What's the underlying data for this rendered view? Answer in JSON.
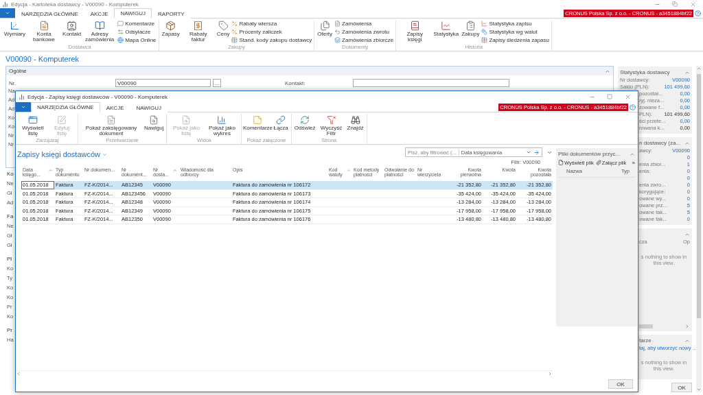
{
  "window": {
    "title": "Edycja - Kartoteka dostawcy - V00090 - Komputerek",
    "company": "CRONUS Polska Sp. z o.o. - CRONUS - a3451884bf22"
  },
  "tabs": [
    {
      "label": "NARZĘDZIA GŁÓWNE",
      "selected": false
    },
    {
      "label": "AKCJE",
      "selected": false
    },
    {
      "label": "NAWIGUJ",
      "selected": true
    },
    {
      "label": "RAPORTY",
      "selected": false
    }
  ],
  "ribbon": [
    {
      "label": "Dostawca",
      "items": [
        {
          "kind": "large",
          "label": "Wymiary"
        },
        {
          "kind": "large",
          "label": "Konta bankowe"
        },
        {
          "kind": "large",
          "label": "Kontakt"
        },
        {
          "kind": "large",
          "label": "Adresy zamówienia"
        },
        {
          "kind": "small",
          "label": "Komentarze"
        },
        {
          "kind": "small",
          "label": "Odsyłacze"
        },
        {
          "kind": "small",
          "label": "Mapa Online"
        }
      ]
    },
    {
      "label": "Zakupy",
      "items": [
        {
          "kind": "large",
          "label": "Zapasy"
        },
        {
          "kind": "large",
          "label": "Rabaty faktur"
        },
        {
          "kind": "large",
          "label": "Ceny"
        },
        {
          "kind": "small",
          "label": "Rabaty wiersza"
        },
        {
          "kind": "small",
          "label": "Procenty zaliczek"
        },
        {
          "kind": "small",
          "label": "Stand. kody zakupu dostawcy"
        }
      ]
    },
    {
      "label": "Dokumenty",
      "items": [
        {
          "kind": "large",
          "label": "Oferty"
        },
        {
          "kind": "small",
          "label": "Zamówienia"
        },
        {
          "kind": "small",
          "label": "Zamówienia zwrotu"
        },
        {
          "kind": "small",
          "label": "Zamówienia zbiorcze"
        }
      ]
    },
    {
      "label": "Historia",
      "items": [
        {
          "kind": "large",
          "label": "Zapisy księgi"
        },
        {
          "kind": "large",
          "label": "Statystyka"
        },
        {
          "kind": "large",
          "label": "Zakupy"
        },
        {
          "kind": "small",
          "label": "Statystyka zapisu"
        },
        {
          "kind": "small",
          "label": "Statystyka wg walut"
        },
        {
          "kind": "small",
          "label": "Zapisy śledzenia zapasu"
        }
      ]
    }
  ],
  "page_title": "V00090 - Komputerek",
  "general": {
    "title": "Ogólne",
    "nr_label": "Nr.",
    "nr_value": "V00090",
    "lookup": "...",
    "contact_label": "Kontakt:",
    "covered_labels": [
      "Na",
      "Ad",
      "Ad",
      "Ko",
      "Ko",
      "Nr",
      "Nr"
    ]
  },
  "sections_below": [
    {
      "header": "Ko",
      "labels": [
        "Ne",
        "Gł",
        "Ad"
      ]
    },
    {
      "header": "Fa",
      "labels": [
        "Ne",
        "Gł",
        "Gł"
      ]
    },
    {
      "header": "Pł",
      "labels": [
        "Ko",
        "Ty",
        "Ko",
        "Ko",
        "Pr",
        "Ko"
      ]
    },
    {
      "header": "Pr",
      "labels": [
        "Ha"
      ]
    }
  ],
  "factboxes": [
    {
      "kind": "stats",
      "title": "Statystyka dostawcy",
      "rows": [
        {
          "label": "Nr dostawcy:",
          "value": "V00090",
          "link": true
        },
        {
          "label": "Saldo (PLN):",
          "value": "101 499,60",
          "link": true
        },
        {
          "label": "pozostał...",
          "value": "0,00",
          "link": true
        },
        {
          "label": "ryj. nieza...",
          "value": "0,00",
          "link": true
        },
        {
          "label": "zowane f...",
          "value": "0,00",
          "link": true
        },
        {
          "label": "PLN):",
          "value": "101 499,60",
          "link": false
        },
        {
          "label": "ści przete...",
          "value": "0,00",
          "link": true
        },
        {
          "label": "rowana k...",
          "value": "0,00",
          "link": false
        }
      ]
    },
    {
      "kind": "stats",
      "title": "n dostawcy (za...",
      "rows": [
        {
          "label": "awcy:",
          "value": "V00090",
          "link": true
        },
        {
          "value": "0",
          "link": true
        },
        {
          "label": "enia zbior...",
          "value": "1",
          "link": true
        },
        {
          "label": "enia:",
          "value": "0",
          "link": true
        },
        {
          "value": "0",
          "link": true
        },
        {
          "label": "enia zwro...",
          "value": "0",
          "link": true
        },
        {
          "label": "korygujące:",
          "value": "0",
          "link": true
        },
        {
          "label": "owane wy...",
          "value": "0",
          "link": true
        },
        {
          "label": "owane prz...",
          "value": "5",
          "link": true
        },
        {
          "label": "owane fak...",
          "value": "5",
          "link": true
        },
        {
          "label": "owane fak...",
          "value": "0",
          "link": true
        }
      ]
    },
    {
      "kind": "list",
      "columns": [
        "cza",
        "Op"
      ],
      "empty": "s nothing to show in this view."
    },
    {
      "kind": "notes",
      "title": "tarze",
      "link": "taj, aby utworzyć nowy ...",
      "empty": "s nothing to show in this view."
    }
  ],
  "ok": "OK",
  "dialog": {
    "title": "Edycja - Zapisy księgi dostawców - V00090 - Komputerek",
    "company": "CRONUS Polska Sp. z o.o. - CRONUS - a3451884bf22",
    "tabs": [
      {
        "label": "NARZĘDZIA GŁÓWNE",
        "selected": true
      },
      {
        "label": "AKCJE",
        "selected": false
      },
      {
        "label": "NAWIGUJ",
        "selected": false
      }
    ],
    "ribbon": [
      {
        "label": "Zarządzaj",
        "items": [
          {
            "label": "Wyświetl listę",
            "disabled": false
          },
          {
            "label": "Edytuj listę",
            "disabled": true
          }
        ]
      },
      {
        "label": "Przetwarzanie",
        "items": [
          {
            "label": "Pokaż zaksięgowany dokument",
            "disabled": false
          },
          {
            "label": "Nawiguj",
            "disabled": false
          }
        ]
      },
      {
        "label": "Widok",
        "items": [
          {
            "label": "Pokaż jako listę",
            "disabled": true
          },
          {
            "label": "Pokaż jako wykres",
            "disabled": false
          }
        ]
      },
      {
        "label": "Pokaż załączone",
        "items": [
          {
            "label": "Komentarze",
            "disabled": false
          },
          {
            "label": "Łącza",
            "disabled": false
          }
        ]
      },
      {
        "label": "Strona",
        "items": [
          {
            "label": "Odśwież",
            "disabled": false
          },
          {
            "label": "Wyczyść Filtr",
            "disabled": false
          },
          {
            "label": "Znajdź",
            "disabled": false
          }
        ]
      }
    ],
    "list_title": "Zapisy księgi dostawców",
    "search": {
      "placeholder": "Pisz, aby filtrować (...",
      "field": "Data księgowania"
    },
    "filter": "Filtr: V00090",
    "table": {
      "columns": [
        {
          "label": "Data księgo...",
          "sorted": true,
          "kind": "text"
        },
        {
          "label": "Typ dokumentu",
          "sorted": false,
          "kind": "text"
        },
        {
          "label": "Nr dokumen...",
          "sorted": false,
          "kind": "text"
        },
        {
          "label": "Nr dokument...",
          "sorted": false,
          "kind": "text"
        },
        {
          "label": "Nr dosta...",
          "sorted": true,
          "kind": "text"
        },
        {
          "label": "Wiadomość dla odbiorcy",
          "sorted": false,
          "kind": "text"
        },
        {
          "label": "Opis",
          "sorted": false,
          "kind": "text"
        },
        {
          "label": "Kod waluty",
          "sorted": true,
          "kind": "text"
        },
        {
          "label": "Kod metody płatności",
          "sorted": false,
          "kind": "text"
        },
        {
          "label": "Odwołanie do płatności",
          "sorted": false,
          "kind": "text"
        },
        {
          "label": "Nr wierzyciela",
          "sorted": false,
          "kind": "text"
        },
        {
          "label": "Kwota pierwotna",
          "sorted": false,
          "kind": "amount"
        },
        {
          "label": "Kwota",
          "sorted": false,
          "kind": "amount"
        },
        {
          "label": "Kwota pozostała",
          "sorted": false,
          "kind": "amount"
        }
      ],
      "rows": [
        {
          "selected": true,
          "cells": [
            "01.05.2018",
            "Faktura",
            "FZ-K/2014...",
            "AB12345",
            "V00090",
            "",
            "Faktura do zamówienia nr 106172",
            "",
            "",
            "",
            "",
            "-21 352,80",
            "-21 352,80",
            "-21 352,80"
          ]
        },
        {
          "selected": false,
          "cells": [
            "01.05.2018",
            "Faktura",
            "FZ-K/2014...",
            "AB123456",
            "V00090",
            "",
            "Faktura do zamówienia nr 106173",
            "",
            "",
            "",
            "",
            "-35 424,00",
            "-35 424,00",
            "-35 424,00"
          ]
        },
        {
          "selected": false,
          "cells": [
            "01.05.2018",
            "Faktura",
            "FZ-K/2014...",
            "AB12348",
            "V00090",
            "",
            "Faktura do zamówienia nr 106174",
            "",
            "",
            "",
            "",
            "-13 284,00",
            "-13 284,00",
            "-13 284,00"
          ]
        },
        {
          "selected": false,
          "cells": [
            "01.05.2018",
            "Faktura",
            "FZ-K/2014...",
            "AB12349",
            "V00090",
            "",
            "Faktura do zamówienia nr 106175",
            "",
            "",
            "",
            "",
            "-17 958,00",
            "-17 958,00",
            "-17 958,00"
          ]
        },
        {
          "selected": false,
          "cells": [
            "01.05.2018",
            "Faktura",
            "FZ-K/2014...",
            "AB12350",
            "V00090",
            "",
            "Faktura do zamówienia nr 106176",
            "",
            "",
            "",
            "",
            "-13 480,80",
            "-13 480,80",
            "-13 480,80"
          ]
        }
      ]
    },
    "factbox": {
      "title": "Pliki dokumentów przyc...",
      "actions": [
        "Wyświetl plik",
        "Załącz plik"
      ],
      "more": "»",
      "columns": [
        "Nazwa",
        "Typ"
      ]
    },
    "ok": "OK"
  }
}
